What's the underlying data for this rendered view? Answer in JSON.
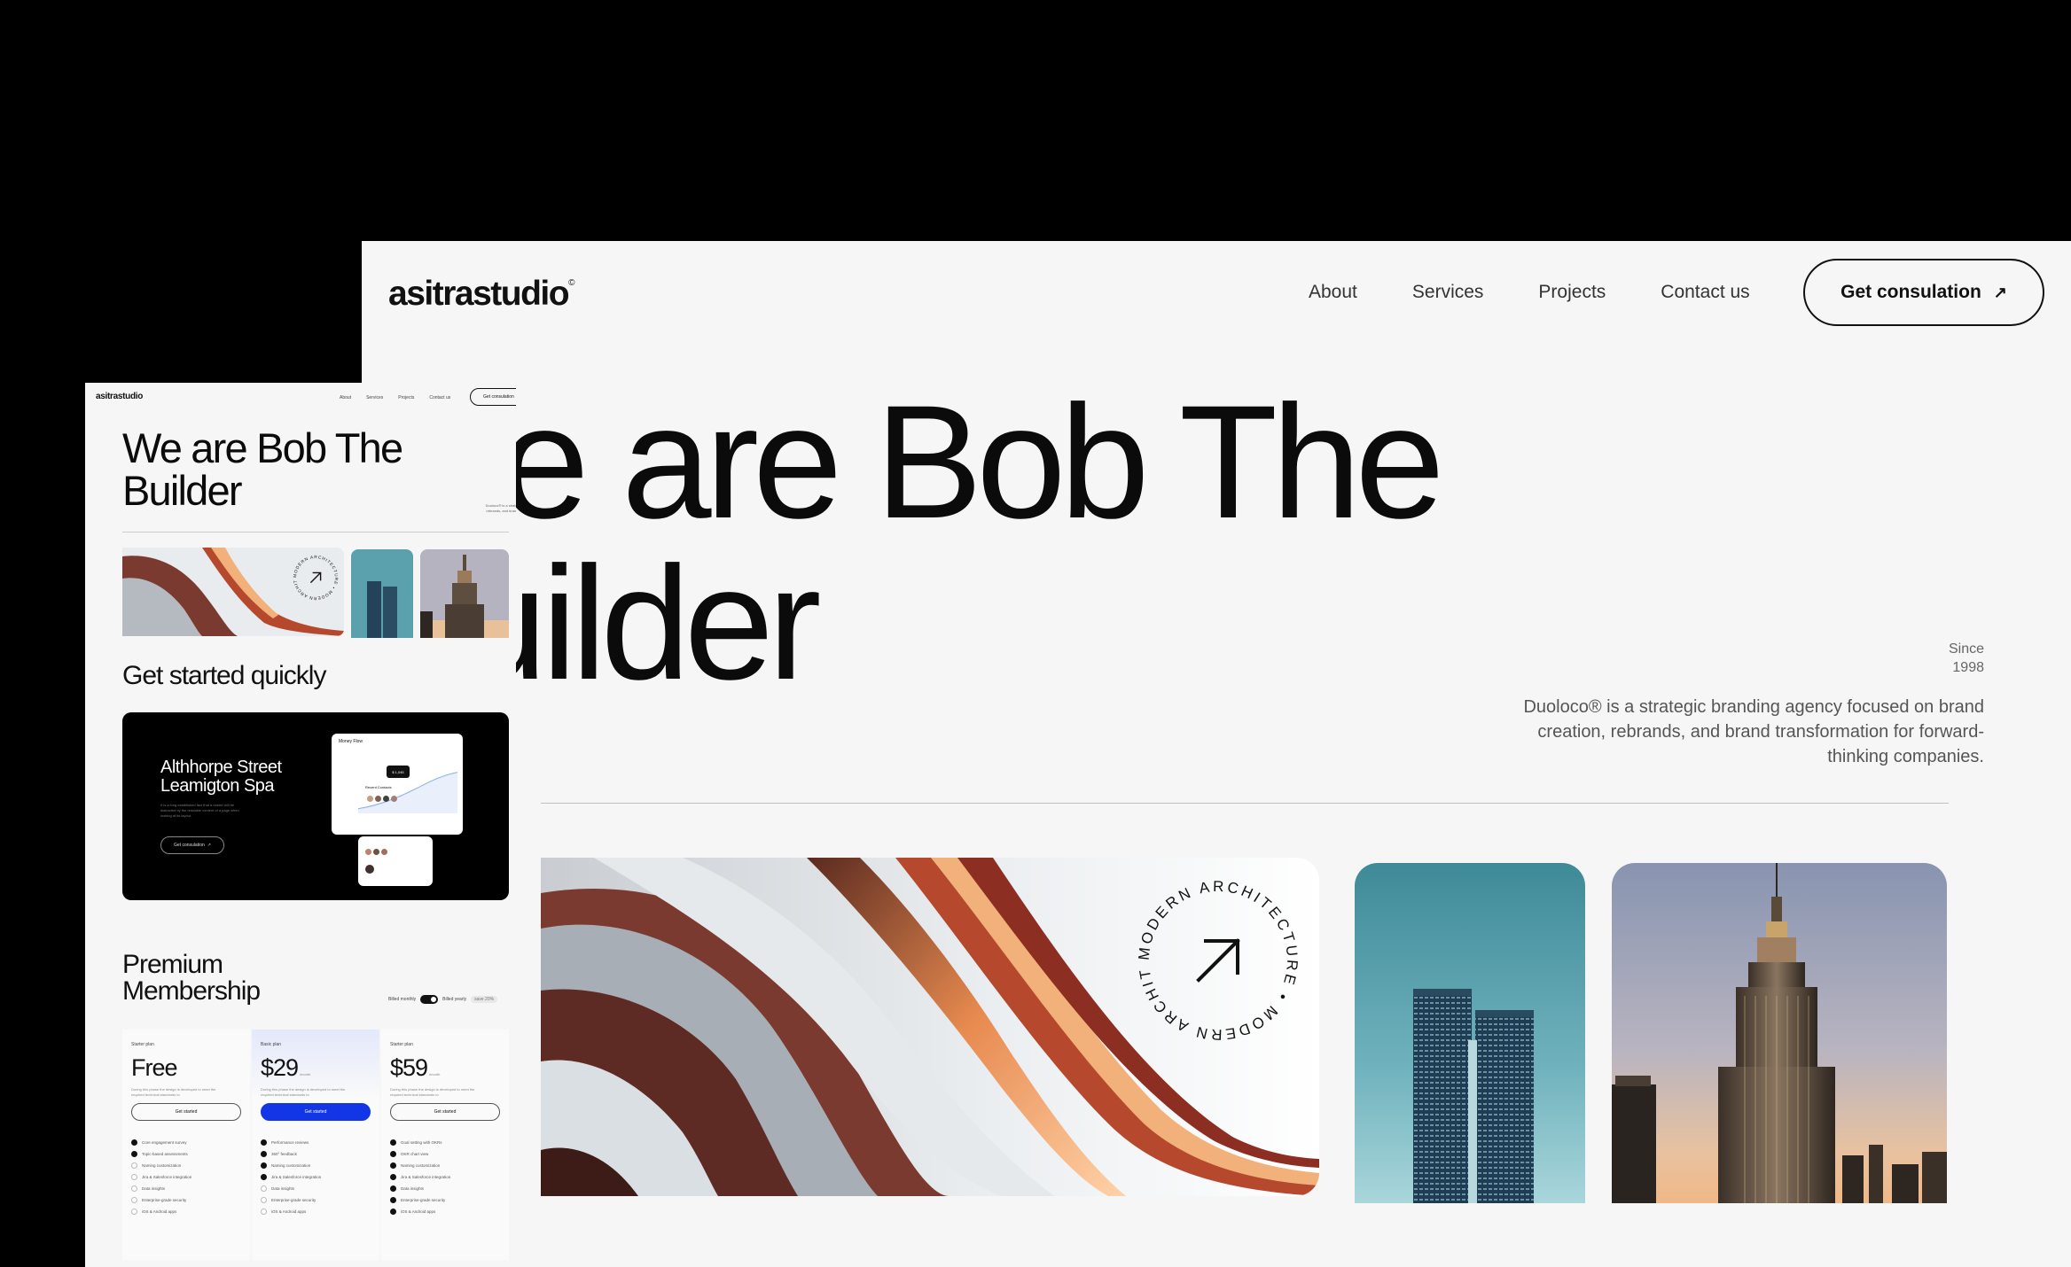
{
  "brand": {
    "name": "asitrastudio",
    "mark": "©"
  },
  "nav": {
    "items": [
      "About",
      "Services",
      "Projects",
      "Contact us"
    ]
  },
  "cta": {
    "label": "Get consulation",
    "icon": "arrow-up-right-icon"
  },
  "hero": {
    "line1": "We are Bob The",
    "line2": "Builder"
  },
  "since": {
    "label": "Since",
    "year": "1998"
  },
  "about": {
    "description": "Duoloco® is a strategic branding agency focused on brand creation, rebrands, and brand transformation for forward-thinking companies."
  },
  "badge": {
    "text": "MODERN ARCHITECTURE • MODERN ARCHITECTURE • "
  },
  "colors": {
    "page_bg": "#f6f6f6",
    "text": "#0b0b0b",
    "accent_blue": "#1236e6",
    "card_bg": "#000000"
  },
  "small": {
    "get_started": "Get started quickly",
    "card": {
      "title_line1": "Althhorpe Street",
      "title_line2": "Leamigton Spa",
      "body": "It is a long established fact that a reader will be distracted by the readable content of a page when looking at its layout.",
      "button": "Get consulation",
      "mock_title": "Money Flow",
      "mock_value": "$ 1,045",
      "mock_contacts": "Recent Contacts"
    },
    "premium_line1": "Premium",
    "premium_line2": "Membership",
    "billing": {
      "monthly": "Billed monthly",
      "yearly": "Billed yearly",
      "save": "save 20%"
    },
    "plans": [
      {
        "name": "Starter plan",
        "price": "Free",
        "period": "",
        "desc": "During this phase the design is developed to meet the required technical standards to",
        "button": "Get started",
        "features": [
          "Core engagement survey",
          "Topic-based assessments",
          "Naming customization",
          "Jira & Salesforce integration",
          "Data insights",
          "Enterprise-grade security",
          "iOS & Android apps"
        ],
        "enabled": [
          true,
          true,
          false,
          false,
          false,
          false,
          false
        ]
      },
      {
        "name": "Basic plan",
        "price": "$29",
        "period": "/month",
        "desc": "During this phase the design is developed to meet the required technical standards to",
        "button": "Get started",
        "features": [
          "Performance reviews",
          "360° feedback",
          "Naming customization",
          "Jira & Salesforce integration",
          "Data insights",
          "Enterprise-grade security",
          "iOS & Android apps"
        ],
        "enabled": [
          true,
          true,
          true,
          true,
          false,
          false,
          false
        ]
      },
      {
        "name": "Starter plan",
        "price": "$59",
        "period": "/month",
        "desc": "During this phase the design is developed to meet the required technical standards to",
        "button": "Get started",
        "features": [
          "Goal setting with OKRs",
          "OKR chart view",
          "Naming customization",
          "Jira & Salesforce integration",
          "Data insights",
          "Enterprise-grade security",
          "iOS & Android apps"
        ],
        "enabled": [
          true,
          true,
          true,
          true,
          true,
          true,
          true
        ]
      }
    ]
  }
}
